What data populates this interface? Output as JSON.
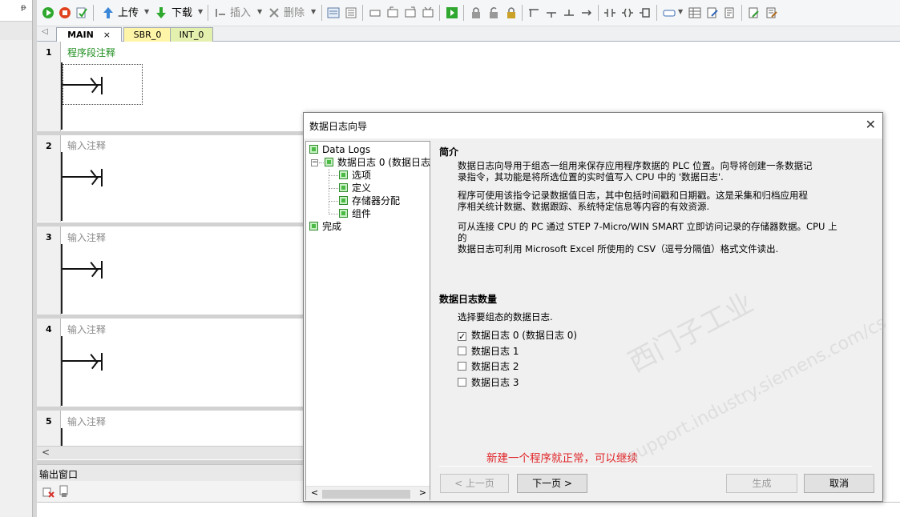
{
  "left_dock": {
    "pin_glyph": "ᵽ"
  },
  "toolbar": {
    "upload_label": "上传",
    "download_label": "下载",
    "insert_label": "插入",
    "delete_label": "删除"
  },
  "tabs": [
    {
      "label": "MAIN",
      "close": "×"
    },
    {
      "label": "SBR_0"
    },
    {
      "label": "INT_0"
    }
  ],
  "networks": [
    {
      "number": "1",
      "comment": "程序段注释",
      "comment_color": "#1c8c1c"
    },
    {
      "number": "2",
      "comment": "输入注释",
      "comment_color": "#8a8a8a"
    },
    {
      "number": "3",
      "comment": "输入注释",
      "comment_color": "#8a8a8a"
    },
    {
      "number": "4",
      "comment": "输入注释",
      "comment_color": "#8a8a8a"
    },
    {
      "number": "5",
      "comment": "输入注释",
      "comment_color": "#8a8a8a"
    }
  ],
  "output": {
    "title": "输出窗口"
  },
  "dialog": {
    "title": "数据日志向导",
    "close_glyph": "✕",
    "tree": {
      "root": "Data Logs",
      "log0": "数据日志 0 (数据日志",
      "options": "选项",
      "define": "定义",
      "memory": "存储器分配",
      "component": "组件",
      "finish": "完成"
    },
    "intro": {
      "heading": "简介",
      "para1_line1": "数据日志向导用于组态一组用来保存应用程序数据的 PLC 位置。向导将创建一条数据记",
      "para1_line2": "录指令，其功能是将所选位置的实时值写入 CPU 中的 '数据日志'.",
      "para2_line1": "程序可使用该指令记录数据值日志，其中包括时间戳和日期戳。这是采集和归档应用程",
      "para2_line2": "序相关统计数据、数据跟踪、系统特定信息等内容的有效资源.",
      "para3_line1": "可从连接 CPU 的 PC 通过 STEP 7-Micro/WIN SMART 立即访问记录的存储器数据。CPU 上的",
      "para3_line2": "数据日志可利用 Microsoft Excel 所使用的 CSV（逗号分隔值）格式文件读出."
    },
    "count": {
      "heading": "数据日志数量",
      "prompt": "选择要组态的数据日志.",
      "options": [
        {
          "label": "数据日志 0 (数据日志 0)",
          "checked": true,
          "mark": "✓"
        },
        {
          "label": "数据日志 1",
          "checked": false,
          "mark": ""
        },
        {
          "label": "数据日志 2",
          "checked": false,
          "mark": ""
        },
        {
          "label": "数据日志 3",
          "checked": false,
          "mark": ""
        }
      ]
    },
    "note": "新建一个程序就正常，可以继续",
    "buttons": {
      "prev": "< 上一页",
      "next": "下一页 >",
      "generate": "生成",
      "cancel": "取消"
    },
    "watermark": {
      "line1": "西门子工业",
      "line2": "support.industry.siemens.com/cs"
    }
  },
  "colors": {
    "accent_green": "#4cbb45",
    "note_red": "#e0262a",
    "tab_sbr": "#fff5a8",
    "tab_int": "#e4f0ad"
  }
}
